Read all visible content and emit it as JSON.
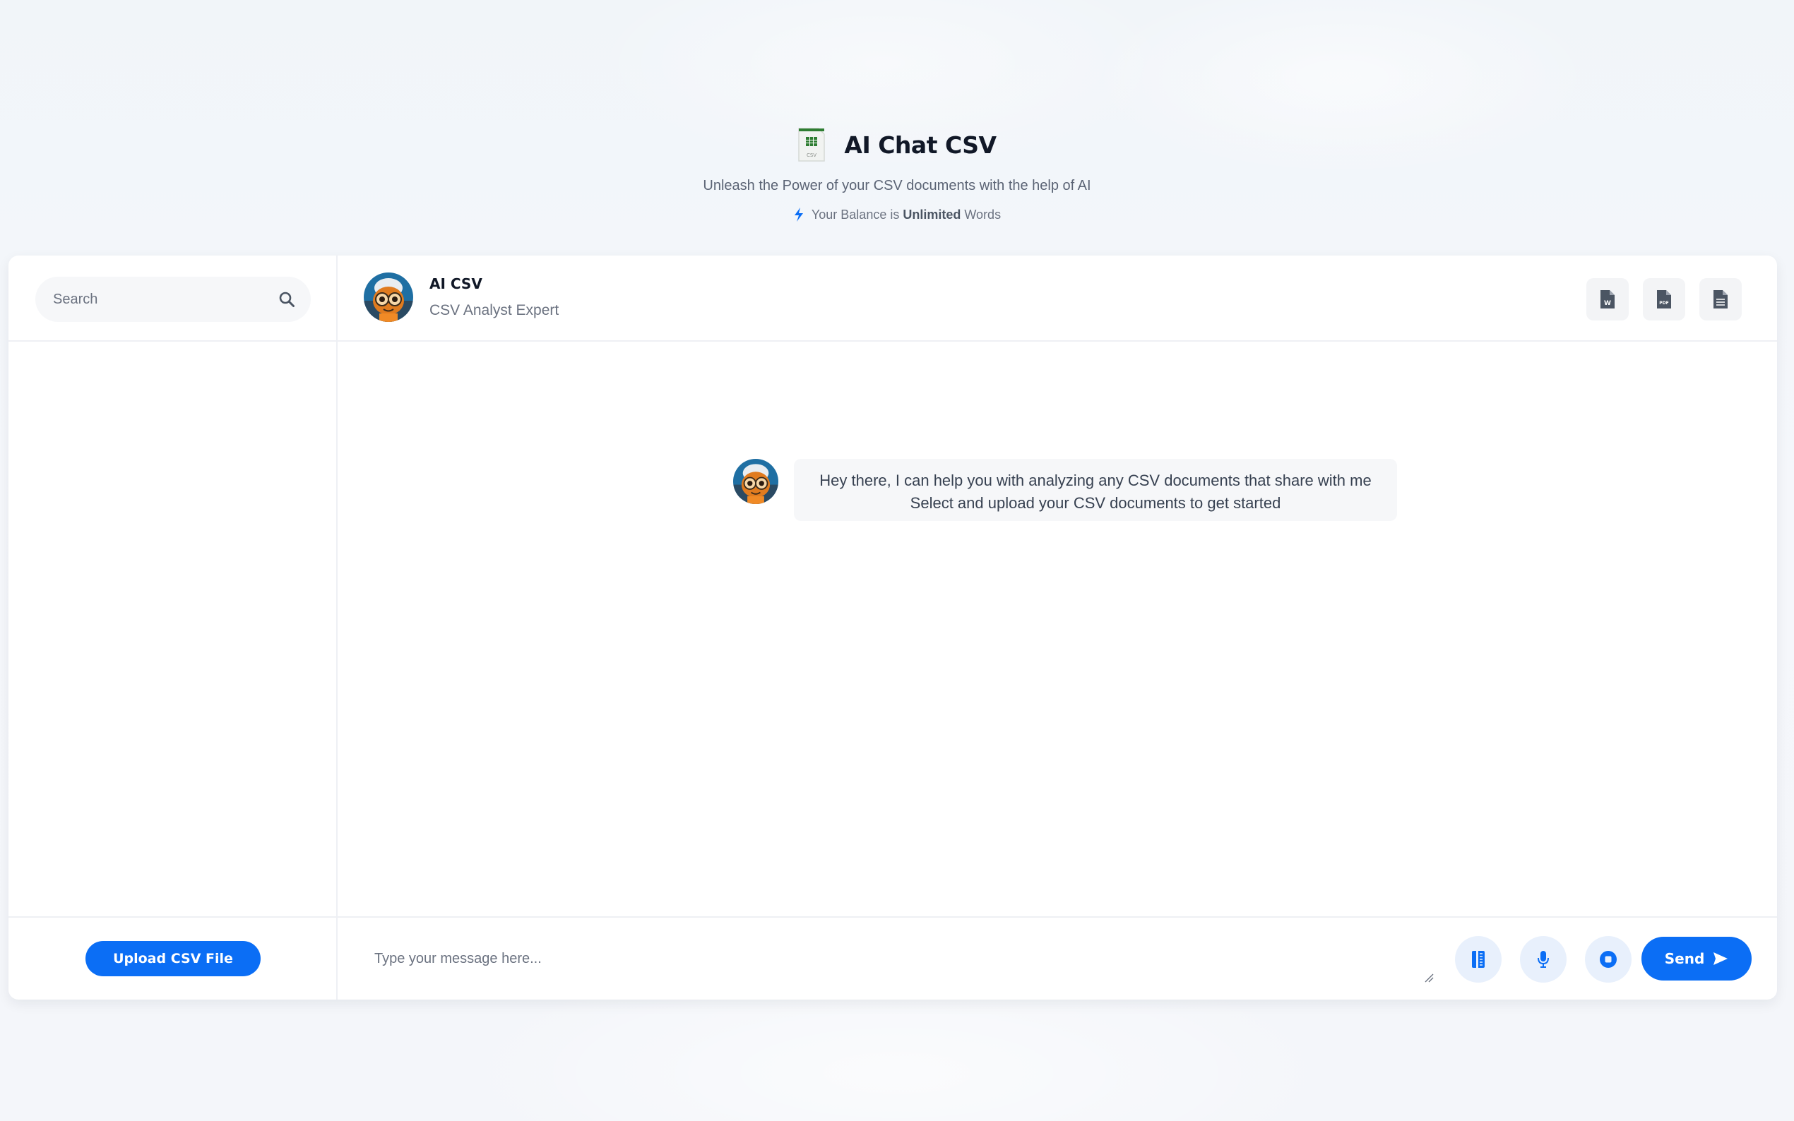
{
  "header": {
    "title": "AI Chat CSV",
    "subtitle": "Unleash the Power of your CSV documents with the help of AI",
    "balance_prefix": "Your Balance is",
    "balance_value": "Unlimited",
    "balance_suffix": "Words",
    "logo_icon": "csv-file-icon",
    "logo_text": "CSV",
    "balance_icon": "bolt-icon"
  },
  "sidebar": {
    "search_placeholder": "Search",
    "upload_label": "Upload CSV File"
  },
  "chat": {
    "bot_name": "AI CSV",
    "bot_role": "CSV Analyst Expert",
    "export_buttons": [
      {
        "icon": "word-file-icon",
        "badge": "W"
      },
      {
        "icon": "pdf-file-icon",
        "badge": "PDF"
      },
      {
        "icon": "text-file-icon"
      }
    ],
    "messages": [
      {
        "sender": "bot",
        "line1": "Hey there, I can help you with analyzing any CSV documents that share with me",
        "line2": "Select and upload your CSV documents to get started"
      }
    ]
  },
  "composer": {
    "placeholder": "Type your message here...",
    "send_label": "Send",
    "prompt_library_icon": "prompt-library-icon",
    "mic_icon": "microphone-icon",
    "stop_icon": "stop-icon",
    "send_icon": "send-arrow-icon"
  },
  "colors": {
    "accent": "#0b6ef5",
    "accent_soft": "#e8f0fc",
    "bubble_bg": "#f6f7f9"
  }
}
